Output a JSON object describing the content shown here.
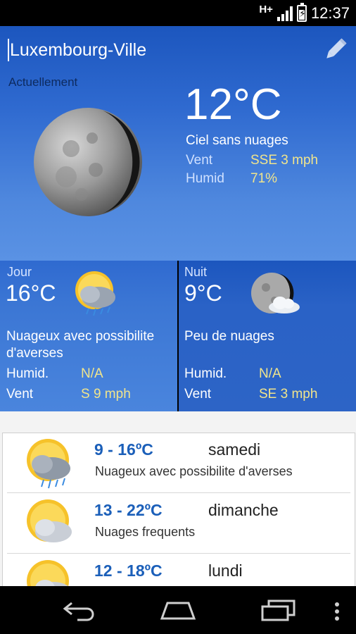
{
  "status": {
    "network": "H+",
    "time": "12:37"
  },
  "header": {
    "city": "Luxembourg-Ville"
  },
  "current": {
    "label": "Actuellement",
    "temperature": "12°C",
    "condition": "Ciel sans nuages",
    "wind_label": "Vent",
    "wind_value": "SSE 3 mph",
    "humidity_label": "Humid",
    "humidity_value": "71%",
    "icon": "moon-icon"
  },
  "day": {
    "title": "Jour",
    "temperature": "16°C",
    "description": "Nuageux avec possibilite d'averses",
    "humidity_label": "Humid.",
    "humidity_value": "N/A",
    "wind_label": "Vent",
    "wind_value": "S 9 mph",
    "icon": "sun-cloud-rain-icon"
  },
  "night": {
    "title": "Nuit",
    "temperature": "9°C",
    "description": "Peu de nuages",
    "humidity_label": "Humid.",
    "humidity_value": "N/A",
    "wind_label": "Vent",
    "wind_value": "SE 3 mph",
    "icon": "moon-cloud-icon"
  },
  "forecast": [
    {
      "temps": "9 - 16ºC",
      "day": "samedi",
      "description": "Nuageux avec possibilite d'averses",
      "icon": "sun-cloud-rain-icon"
    },
    {
      "temps": "13 - 22ºC",
      "day": "dimanche",
      "description": "Nuages frequents",
      "icon": "sun-cloud-icon"
    },
    {
      "temps": "12 - 18ºC",
      "day": "lundi",
      "description": "",
      "icon": "sun-cloud-icon"
    }
  ],
  "colors": {
    "accent": "#1b5fb9",
    "value_yellow": "#f1e58c",
    "header_blue": "#2f6ad0"
  }
}
